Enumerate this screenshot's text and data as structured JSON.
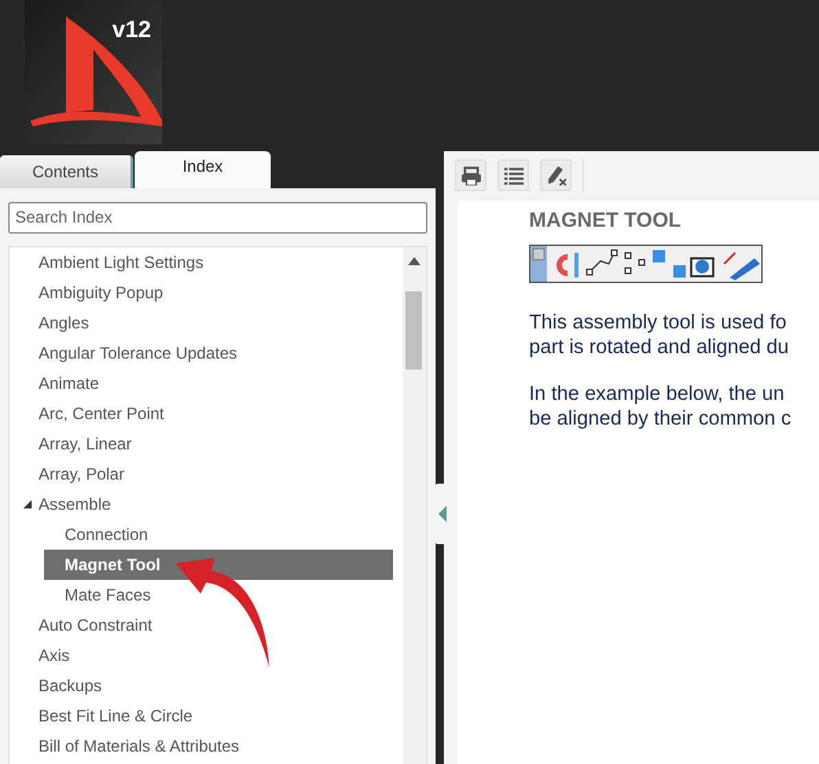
{
  "logo": {
    "version": "v12"
  },
  "tabs": [
    {
      "label": "Contents",
      "selected": false
    },
    {
      "label": "Index",
      "selected": true
    }
  ],
  "search": {
    "placeholder": "Search Index"
  },
  "index_items": [
    {
      "label": "Ambient Light Settings",
      "selected": false
    },
    {
      "label": "Ambiguity Popup",
      "selected": false
    },
    {
      "label": "Angles",
      "selected": false
    },
    {
      "label": "Angular Tolerance Updates",
      "selected": false
    },
    {
      "label": "Animate",
      "selected": false
    },
    {
      "label": "Arc, Center Point",
      "selected": false
    },
    {
      "label": "Array, Linear",
      "selected": false
    },
    {
      "label": "Array, Polar",
      "selected": false
    },
    {
      "label": "Assemble",
      "selected": false,
      "expanded": true,
      "children": [
        {
          "label": "Connection",
          "selected": false
        },
        {
          "label": "Magnet Tool",
          "selected": true
        },
        {
          "label": "Mate Faces",
          "selected": false
        }
      ]
    },
    {
      "label": "Auto Constraint",
      "selected": false
    },
    {
      "label": "Axis",
      "selected": false
    },
    {
      "label": "Backups",
      "selected": false
    },
    {
      "label": "Best Fit Line & Circle",
      "selected": false
    },
    {
      "label": "Bill of Materials & Attributes",
      "selected": false
    }
  ],
  "topic": {
    "title": "MAGNET TOOL",
    "paragraphs": [
      [
        "This assembly tool is used fo",
        "part is rotated and aligned du"
      ],
      [
        "In the example below, the un",
        "be aligned by their common c"
      ]
    ]
  }
}
